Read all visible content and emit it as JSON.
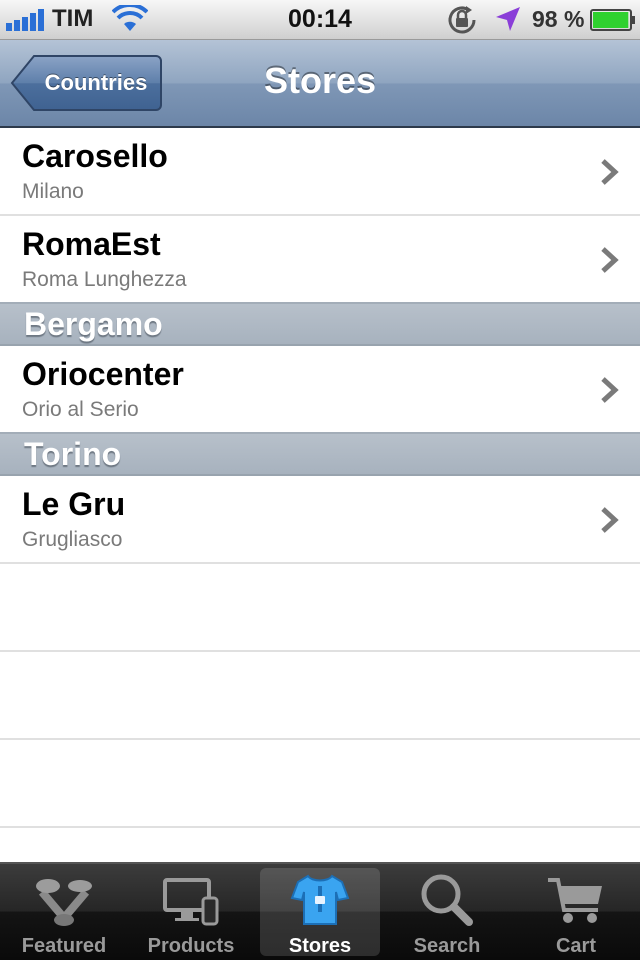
{
  "status_bar": {
    "carrier": "TIM",
    "time": "00:14",
    "battery_percent": "98 %",
    "signal_icon": "signal-bars-icon",
    "wifi_icon": "wifi-icon",
    "orientation_lock_icon": "orientation-lock-icon",
    "location_icon": "location-arrow-icon",
    "battery_icon": "battery-icon",
    "battery_level": 0.98,
    "battery_color": "#2fd12f"
  },
  "nav": {
    "back_label": "Countries",
    "title": "Stores"
  },
  "list": {
    "groups": [
      {
        "header": "",
        "rows": [
          {
            "title": "Carosello",
            "subtitle": "Milano"
          },
          {
            "title": "RomaEst",
            "subtitle": "Roma Lunghezza"
          }
        ]
      },
      {
        "header": "Bergamo",
        "rows": [
          {
            "title": "Oriocenter",
            "subtitle": "Orio al Serio"
          }
        ]
      },
      {
        "header": "Torino",
        "rows": [
          {
            "title": "Le Gru",
            "subtitle": "Grugliasco"
          }
        ]
      }
    ]
  },
  "tab_bar": {
    "tabs": [
      {
        "label": "Featured",
        "icon": "featured-icon",
        "active": false
      },
      {
        "label": "Products",
        "icon": "products-icon",
        "active": false
      },
      {
        "label": "Stores",
        "icon": "stores-icon",
        "active": true
      },
      {
        "label": "Search",
        "icon": "search-icon",
        "active": false
      },
      {
        "label": "Cart",
        "icon": "cart-icon",
        "active": false
      }
    ]
  },
  "colors": {
    "nav_bar": "#7f97b6",
    "section_header": "#aeb8c3",
    "tab_bar": "#1a1a1a"
  }
}
